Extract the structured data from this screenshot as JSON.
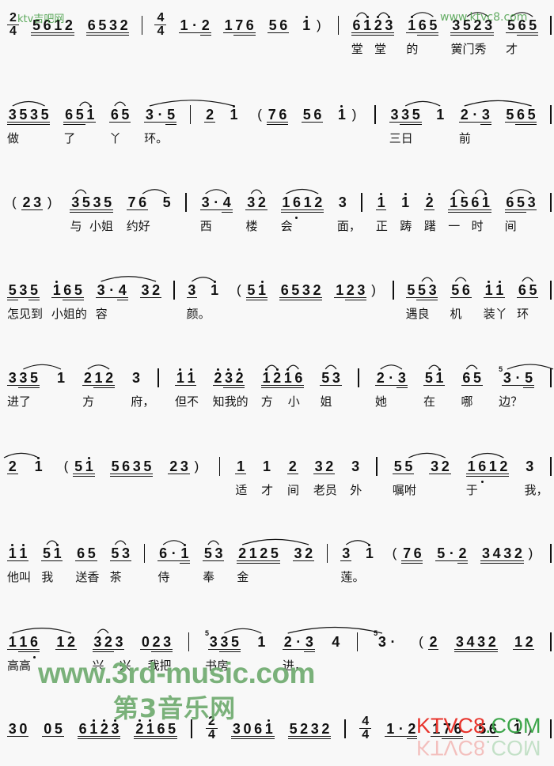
{
  "colors": {
    "watermark_green": "#3f9a3f",
    "big_green": "#74ae74",
    "logo_red": "#e8332b",
    "logo_green": "#3ca54a"
  },
  "watermarks": {
    "top_left": "ktv吉吧网",
    "top_right": "www.ktvc8.com",
    "site_url": "www.3rd-music.com",
    "site_name": "第3音乐网",
    "logo_red": "KTVC8",
    "logo_green": ".COM"
  },
  "score": {
    "notation": "jianpu",
    "lines": [
      {
        "tokens": [
          {
            "type": "time",
            "top": "2",
            "bottom": "4"
          },
          {
            "n": "5612",
            "b": "2222"
          },
          {
            "n": "6532",
            "b": "2222"
          },
          {
            "type": "bar"
          },
          {
            "type": "time",
            "top": "4",
            "bottom": "4"
          },
          {
            "n": "1·2",
            "b": "112"
          },
          {
            "n": "176",
            "b": "122"
          },
          {
            "n": "56",
            "b": "11"
          },
          {
            "n": "1̇",
            "b": "0",
            "post": ")"
          },
          {
            "type": "bar"
          },
          {
            "n": "61̇2̇3̇",
            "b": "2222",
            "s": [
              [
                0,
                1
              ],
              [
                2,
                3
              ]
            ],
            "l": "堂   堂"
          },
          {
            "n": "1̇65",
            "b": "122",
            "s": [
              [
                0,
                2
              ]
            ],
            "l": "的"
          },
          {
            "n": "3523",
            "b": "2222",
            "s": [
              [
                1,
                3
              ]
            ],
            "l": "黉门秀"
          },
          {
            "n": "565",
            "b": "122",
            "s": [
              [
                0,
                2
              ]
            ],
            "l": "才"
          },
          {
            "type": "bar"
          }
        ]
      },
      {
        "tokens": [
          {
            "n": "3535",
            "b": "2222",
            "s": [
              [
                0,
                3
              ]
            ],
            "l": "做"
          },
          {
            "n": "651̇",
            "b": "221",
            "s": [
              [
                1,
                2
              ]
            ],
            "l": "了"
          },
          {
            "n": "65",
            "b": "11",
            "s": [
              [
                0,
                1
              ]
            ],
            "l": "丫"
          },
          {
            "n": "3·5",
            "b": "112",
            "xs": 0,
            "l": "环。"
          },
          {
            "type": "bar"
          },
          {
            "n": "2",
            "b": "1"
          },
          {
            "n": "1̇",
            "b": "0",
            "xe": 0
          },
          {
            "n": "76",
            "b": "22",
            "pre": "("
          },
          {
            "n": "56",
            "b": "11"
          },
          {
            "n": "1̇",
            "b": "0",
            "post": ")"
          },
          {
            "type": "bar"
          },
          {
            "n": "335",
            "b": "122",
            "xs": 1,
            "l": "三日"
          },
          {
            "n": "1",
            "b": "0",
            "xe": 0
          },
          {
            "n": "2·3",
            "b": "112",
            "xs": 0,
            "l": "前"
          },
          {
            "n": "565",
            "b": "122",
            "xe": 2
          },
          {
            "type": "bar"
          }
        ]
      },
      {
        "tokens": [
          {
            "n": "23",
            "b": "11",
            "pre": "(",
            "post": ")"
          },
          {
            "n": "3535",
            "b": "2222",
            "s": [
              [
                0,
                1
              ]
            ],
            "l": "与  小姐"
          },
          {
            "n": "76",
            "b": "11",
            "xs": 1,
            "l": "约好"
          },
          {
            "n": "5",
            "b": "0",
            "xe": 0
          },
          {
            "type": "bar"
          },
          {
            "n": "3·4",
            "b": "112",
            "s": [
              [
                0,
                2
              ]
            ],
            "l": "西"
          },
          {
            "n": "32",
            "b": "11",
            "s": [
              [
                0,
                1
              ]
            ],
            "l": "楼"
          },
          {
            "n": "16̣12",
            "b": "2222",
            "s": [
              [
                0,
                3
              ]
            ],
            "l": "会"
          },
          {
            "n": "3",
            "b": "0",
            "l": "面，"
          },
          {
            "type": "bar"
          },
          {
            "n": "1̇",
            "b": "1",
            "l": "正"
          },
          {
            "n": "1̇",
            "b": "0",
            "l": "踌"
          },
          {
            "n": "2̇",
            "b": "1",
            "l": "躇"
          },
          {
            "n": "1̇561̇",
            "b": "2222",
            "s": [
              [
                0,
                1
              ],
              [
                2,
                3
              ]
            ],
            "l": "一   时"
          },
          {
            "n": "653",
            "b": "221",
            "s": [
              [
                0,
                2
              ]
            ],
            "l": "间"
          },
          {
            "type": "bar"
          }
        ]
      },
      {
        "tokens": [
          {
            "n": "535",
            "b": "212",
            "l": "怎见到"
          },
          {
            "n": "1̇65",
            "b": "122",
            "l": "小姐的"
          },
          {
            "n": "3·4",
            "b": "112",
            "xs": 0,
            "l": "容"
          },
          {
            "n": "32",
            "b": "11",
            "xe": 1
          },
          {
            "type": "bar"
          },
          {
            "n": "3",
            "b": "1",
            "xs": 0,
            "l": "颜。"
          },
          {
            "n": "1̇",
            "b": "0",
            "xe": 0
          },
          {
            "n": "51̇",
            "b": "22",
            "pre": "("
          },
          {
            "n": "6532",
            "b": "2222"
          },
          {
            "n": "123",
            "b": "122",
            "post": ")"
          },
          {
            "type": "bar"
          },
          {
            "n": "553",
            "b": "122",
            "s": [
              [
                1,
                2
              ]
            ],
            "l": "遇良"
          },
          {
            "n": "56",
            "b": "11",
            "s": [
              [
                0,
                1
              ]
            ],
            "l": "机"
          },
          {
            "n": "1̇1̇",
            "b": "11",
            "l": "装丫"
          },
          {
            "n": "65",
            "b": "11",
            "s": [
              [
                0,
                1
              ]
            ],
            "l": "环"
          },
          {
            "type": "bar"
          }
        ]
      },
      {
        "tokens": [
          {
            "n": "335",
            "b": "122",
            "xs": 1,
            "l": "进了"
          },
          {
            "n": "1",
            "b": "0",
            "xe": 0
          },
          {
            "n": "212",
            "b": "122",
            "s": [
              [
                0,
                2
              ]
            ],
            "l": "方"
          },
          {
            "n": "3",
            "b": "0",
            "l": "府，"
          },
          {
            "type": "bar"
          },
          {
            "n": "1̇1̇",
            "b": "11",
            "l": "但不"
          },
          {
            "n": "2̇3̇2̇",
            "b": "122",
            "l": "知我的"
          },
          {
            "n": "1̇2̇1̇6",
            "b": "2222",
            "s": [
              [
                0,
                1
              ],
              [
                2,
                3
              ]
            ],
            "l": "方    小"
          },
          {
            "n": "53",
            "b": "11",
            "s": [
              [
                0,
                1
              ]
            ],
            "l": "姐"
          },
          {
            "type": "bar"
          },
          {
            "n": "2·3",
            "b": "112",
            "s": [
              [
                0,
                2
              ]
            ],
            "l": "她"
          },
          {
            "n": "51̇",
            "b": "11",
            "s": [
              [
                0,
                1
              ]
            ],
            "l": "在"
          },
          {
            "n": "65",
            "b": "11",
            "s": [
              [
                0,
                1
              ]
            ],
            "l": "哪"
          },
          {
            "n": "3·5",
            "b": "112",
            "g": "5",
            "xs": 0,
            "l": "边？"
          },
          {
            "type": "bar"
          }
        ]
      },
      {
        "tokens": [
          {
            "n": "2",
            "b": "1"
          },
          {
            "n": "1̇",
            "b": "0",
            "xe": 0
          },
          {
            "n": "51̇",
            "b": "22",
            "pre": "("
          },
          {
            "n": "5635",
            "b": "2222"
          },
          {
            "n": "23",
            "b": "11",
            "post": ")"
          },
          {
            "type": "bar"
          },
          {
            "n": "1",
            "b": "1",
            "l": "适"
          },
          {
            "n": "1",
            "b": "0",
            "l": "才"
          },
          {
            "n": "2",
            "b": "1",
            "l": "间"
          },
          {
            "n": "32",
            "b": "11",
            "l": "老员"
          },
          {
            "n": "3",
            "b": "0",
            "l": "外"
          },
          {
            "type": "bar"
          },
          {
            "n": "55",
            "b": "11",
            "xs": 1,
            "l": "嘱咐"
          },
          {
            "n": "32",
            "b": "11",
            "xe": 1
          },
          {
            "n": "16̣12",
            "b": "2222",
            "s": [
              [
                0,
                3
              ]
            ],
            "l": "于"
          },
          {
            "n": "3",
            "b": "0",
            "l": "我，"
          },
          {
            "type": "bar"
          }
        ]
      },
      {
        "tokens": [
          {
            "n": "1̇1̇",
            "b": "11",
            "l": "他叫"
          },
          {
            "n": "51̇",
            "b": "11",
            "s": [
              [
                0,
                1
              ]
            ],
            "l": "我"
          },
          {
            "n": "65",
            "b": "11",
            "l": "送香"
          },
          {
            "n": "53",
            "b": "11",
            "s": [
              [
                0,
                1
              ]
            ],
            "l": "茶"
          },
          {
            "type": "bar"
          },
          {
            "n": "6·1̇",
            "b": "112",
            "s": [
              [
                0,
                2
              ]
            ],
            "l": "侍"
          },
          {
            "n": "53",
            "b": "11",
            "s": [
              [
                0,
                1
              ]
            ],
            "l": "奉"
          },
          {
            "n": "2125",
            "b": "2222",
            "xs": 0,
            "l": "金"
          },
          {
            "n": "32",
            "b": "11",
            "xe": 1
          },
          {
            "type": "bar"
          },
          {
            "n": "3",
            "b": "1",
            "xs": 0,
            "l": "莲。"
          },
          {
            "n": "1̇",
            "b": "0",
            "xe": 0
          },
          {
            "n": "76",
            "b": "22",
            "pre": "("
          },
          {
            "n": "5·2",
            "b": "112"
          },
          {
            "n": "3432",
            "b": "2222",
            "post": ")"
          },
          {
            "type": "bar"
          }
        ]
      },
      {
        "tokens": [
          {
            "n": "116̣",
            "b": "122",
            "xs": 0,
            "l": "高高"
          },
          {
            "n": "12",
            "b": "11",
            "xe": 1
          },
          {
            "n": "323",
            "b": "221",
            "s": [
              [
                0,
                1
              ]
            ],
            "l": "兴    兴"
          },
          {
            "n": "023",
            "b": "122",
            "l": "  我把"
          },
          {
            "type": "bar"
          },
          {
            "n": "335",
            "b": "122",
            "g": "5",
            "xs": 1,
            "l": "书房"
          },
          {
            "n": "1",
            "b": "0",
            "xe": 0
          },
          {
            "n": "2·3",
            "b": "112",
            "xs": 0,
            "l": "进，"
          },
          {
            "n": "4",
            "b": "0"
          },
          {
            "type": "bar"
          },
          {
            "n": "3·",
            "b": "00",
            "g": "5",
            "xe": 0
          },
          {
            "n": "2",
            "b": "1",
            "pre": "("
          },
          {
            "n": "3432",
            "b": "2222"
          },
          {
            "n": "12",
            "b": "11"
          },
          {
            "type": "bar"
          }
        ]
      },
      {
        "tokens": [
          {
            "n": "30",
            "b": "11"
          },
          {
            "n": "05",
            "b": "11"
          },
          {
            "n": "61̇2̇3̇",
            "b": "2222"
          },
          {
            "n": "2̇1̇65",
            "b": "2222"
          },
          {
            "type": "bar"
          },
          {
            "type": "time",
            "top": "2",
            "bottom": "4"
          },
          {
            "n": "3061̇",
            "b": "2222"
          },
          {
            "n": "5232",
            "b": "2222"
          },
          {
            "type": "bar"
          },
          {
            "type": "time",
            "top": "4",
            "bottom": "4"
          },
          {
            "n": "1·2",
            "b": "112"
          },
          {
            "n": "176",
            "b": "122"
          },
          {
            "n": "56",
            "b": "11"
          },
          {
            "n": "1̇",
            "b": "0",
            "post": ")"
          },
          {
            "type": "bar"
          }
        ]
      }
    ]
  }
}
